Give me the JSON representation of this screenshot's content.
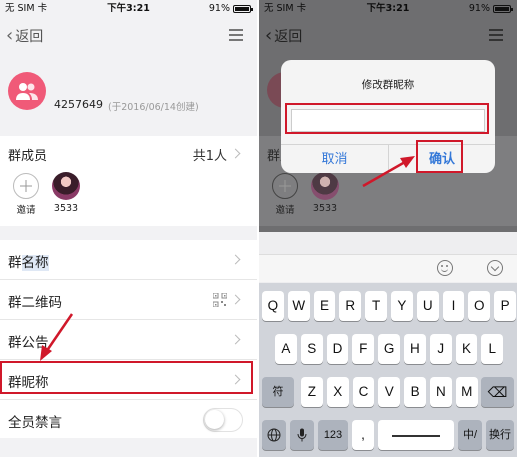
{
  "status_bar": {
    "carrier": "无 SIM 卡",
    "time": "下午3:21",
    "battery": "91%",
    "battery_level": 0.91
  },
  "nav": {
    "back_label": "返回"
  },
  "group": {
    "id_fragment": "4257649",
    "created": "(于2016/06/14创建)"
  },
  "members": {
    "title": "群成员",
    "count": "共1人",
    "items": [
      {
        "name": "邀请",
        "type": "invite"
      },
      {
        "name": "3533",
        "type": "member"
      }
    ]
  },
  "settings": {
    "items": [
      {
        "label": "群名称",
        "control": "chevron"
      },
      {
        "label": "群二维码",
        "control": "qr"
      },
      {
        "label": "群公告",
        "control": "chevron"
      },
      {
        "label": "群昵称",
        "control": "chevron"
      },
      {
        "label": "全员禁言",
        "control": "toggle",
        "toggle_on": false
      }
    ]
  },
  "dialog": {
    "title": "修改群昵称",
    "input_value": "",
    "cancel_label": "取消",
    "confirm_label": "确认"
  },
  "keyboard": {
    "row1": [
      "Q",
      "W",
      "E",
      "R",
      "T",
      "Y",
      "U",
      "I",
      "O",
      "P"
    ],
    "row2": [
      "A",
      "S",
      "D",
      "F",
      "G",
      "H",
      "J",
      "K",
      "L"
    ],
    "row3": [
      "Z",
      "X",
      "C",
      "V",
      "B",
      "N",
      "M"
    ],
    "shift_label": "符",
    "numbers_label": "123",
    "punct_label": ",",
    "lang_label": "中/",
    "return_label": "换行"
  },
  "colors": {
    "highlight_red": "#d0182a",
    "ios_blue": "#3478d8",
    "avatar_pink": "#f05a78"
  }
}
